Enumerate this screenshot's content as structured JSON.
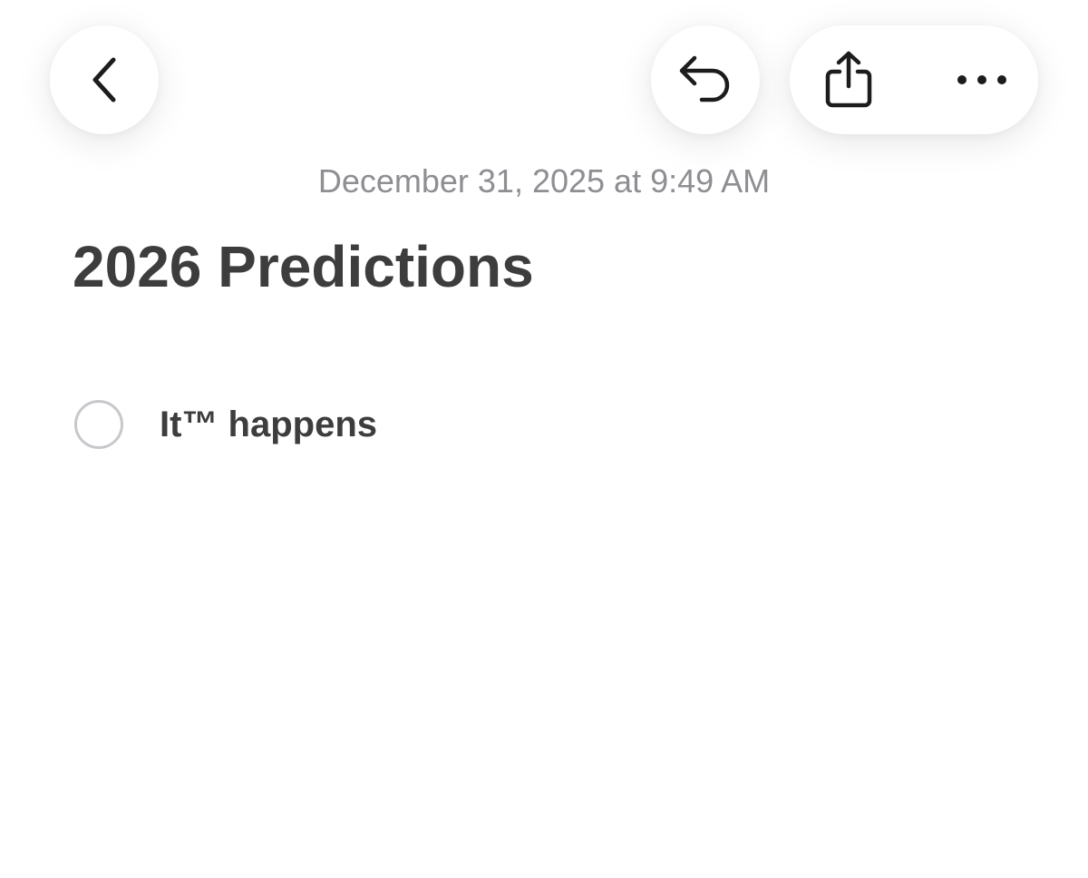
{
  "toolbar": {
    "back_icon": "chevron-left-icon",
    "undo_icon": "undo-arrow-icon",
    "share_icon": "share-icon",
    "more_icon": "ellipsis-icon"
  },
  "note": {
    "timestamp": "December 31, 2025 at 9:49 AM",
    "title": "2026 Predictions",
    "checklist": [
      {
        "text": "It™ happens",
        "checked": false
      }
    ]
  },
  "colors": {
    "text_primary": "#3d3d3d",
    "text_secondary": "#8e8e93",
    "checkbox_border": "#c8c8cc",
    "icon": "#1c1c1e"
  }
}
